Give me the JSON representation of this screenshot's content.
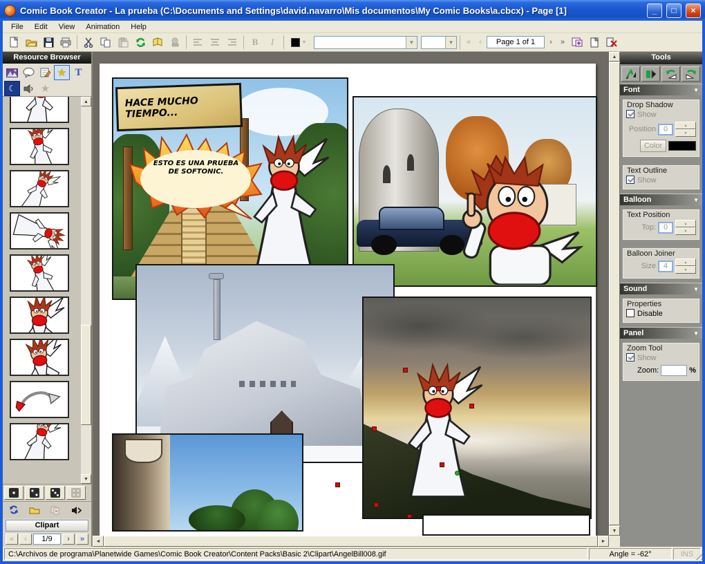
{
  "window": {
    "title": "Comic Book Creator - La prueba (C:\\Documents and Settings\\david.navarro\\Mis documentos\\My Comic Books\\a.cbcx) - Page [1]"
  },
  "menu": {
    "items": [
      {
        "label": "File"
      },
      {
        "label": "Edit"
      },
      {
        "label": "View"
      },
      {
        "label": "Animation"
      },
      {
        "label": "Help"
      }
    ]
  },
  "toolbar": {
    "page_nav_label": "Page 1 of 1",
    "bold_label": "B",
    "italic_label": "I"
  },
  "resource_browser": {
    "title": "Resource Browser",
    "clipart_button": "Clipart",
    "page_indicator": "1/9"
  },
  "tools_panel": {
    "title": "Tools",
    "font_section": {
      "header": "Font",
      "drop_shadow": {
        "title": "Drop Shadow",
        "show_label": "Show",
        "position_label": "Position",
        "position_value": "0",
        "color_label": "Color",
        "shadow_color": "#000000"
      },
      "text_outline": {
        "title": "Text Outline",
        "show_label": "Show"
      }
    },
    "balloon_section": {
      "header": "Balloon",
      "text_position": {
        "title": "Text Position",
        "top_label": "Top:",
        "top_value": "0"
      },
      "balloon_joiner": {
        "title": "Balloon Joiner",
        "size_label": "Size",
        "size_value": "4"
      }
    },
    "sound_section": {
      "header": "Sound",
      "properties": {
        "title": "Properties",
        "disable_label": "Disable"
      }
    },
    "panel_section": {
      "header": "Panel",
      "zoom_tool": {
        "title": "Zoom Tool",
        "show_label": "Show",
        "zoom_label": "Zoom:",
        "zoom_value": "",
        "percent_label": "%"
      }
    }
  },
  "canvas": {
    "caption_text": "HACE MUCHO TIEMPO...",
    "balloon_text": "ESTO ES UNA PRUEBA DE SOFTONIC."
  },
  "status_bar": {
    "file_path": "C:\\Archivos de programa\\Planetwide Games\\Comic Book Creator\\Content Packs\\Basic 2\\Clipart\\AngelBill008.gif",
    "angle": "Angle = -62°",
    "ins": "INS"
  },
  "icons": {
    "minimize": "_",
    "maximize": "□",
    "close": "×",
    "chevron_down": "▼",
    "combo_drop": "▼",
    "nav_first": "«",
    "nav_prev": "‹",
    "nav_next": "›",
    "nav_last": "»",
    "arrow_up": "▲",
    "arrow_down": "▼",
    "arrow_left": "◄",
    "arrow_right": "►",
    "star": "★",
    "moon": "☾",
    "text_tab": "T",
    "spin_up": "▲",
    "spin_down": "▼"
  },
  "colors": {
    "titlebar_blue": "#1c5cd8",
    "selection_handle_red": "#c41414",
    "selection_handle_green": "#1db51d",
    "text_color_swatch": "#000000"
  }
}
